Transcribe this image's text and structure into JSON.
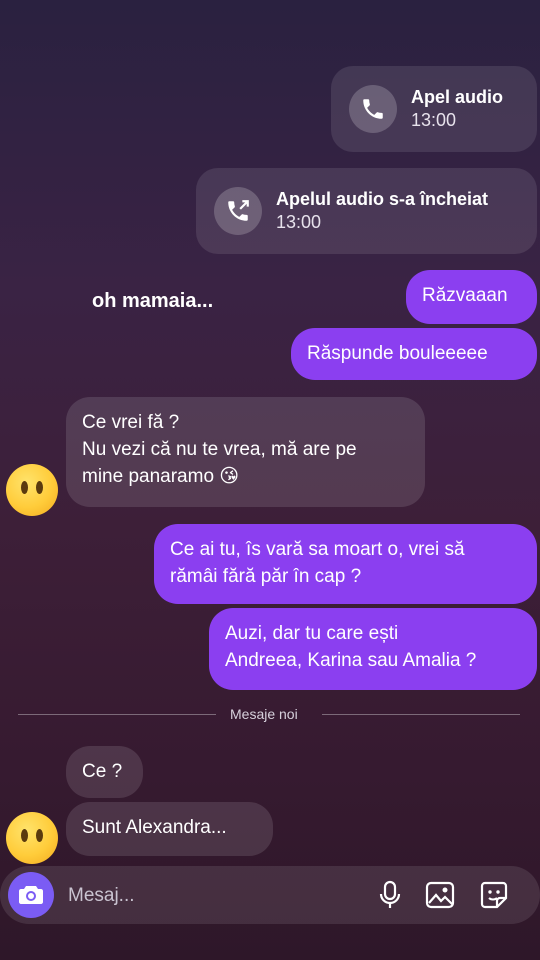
{
  "messages": {
    "call_audio": {
      "title": "Apel audio",
      "time": "13:00"
    },
    "call_ended": {
      "title": "Apelul audio s-a încheiat",
      "time": "13:00"
    },
    "note": "oh mamaia...",
    "out1": "Răzvaaan",
    "out2": "Răspunde bouleeeee",
    "in1": "Ce vrei fă ?\nNu vezi că nu te vrea, mă are pe\nmine panaramo 😘",
    "out3": "Ce ai tu, îs vară sa moart o, vrei să\nrămâi fără păr în cap ?",
    "out4": "Auzi, dar tu care ești\nAndreea, Karina sau Amalia ?",
    "divider": "Mesaje noi",
    "in2": "Ce ?",
    "in3": "Sunt Alexandra..."
  },
  "composer": {
    "placeholder": "Mesaj..."
  },
  "icons": {
    "call": "phone-icon",
    "call_ended": "phone-outgoing-icon",
    "avatar": "neutral-face-emoji",
    "camera": "camera-icon",
    "mic": "microphone-icon",
    "gallery": "image-icon",
    "sticker": "sticker-icon"
  },
  "colors": {
    "outgoing_bubble": "#8b3ff0",
    "camera_button": "#7b5cf4"
  }
}
